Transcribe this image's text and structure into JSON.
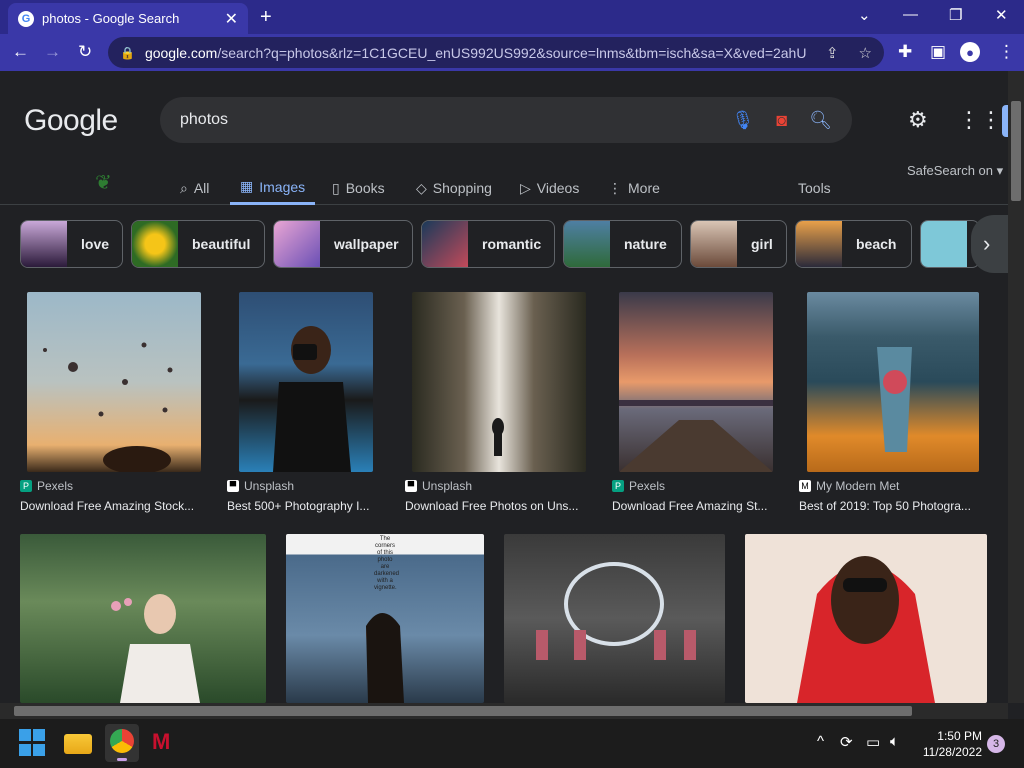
{
  "browser": {
    "tab_title": "photos - Google Search",
    "tab_favicon": "G",
    "url_host": "google.com",
    "url_rest": "/search?q=photos&rlz=1C1GCEU_enUS992US992&source=lnms&tbm=isch&sa=X&ved=2ahU..."
  },
  "page": {
    "logo": "Google",
    "query": "photos",
    "nav": [
      "All",
      "Images",
      "Books",
      "Shopping",
      "Videos",
      "More"
    ],
    "tools": "Tools",
    "safesearch": "SafeSearch on",
    "chips": [
      "love",
      "beautiful",
      "wallpaper",
      "romantic",
      "nature",
      "girl",
      "beach"
    ],
    "results": [
      {
        "source": "Pexels",
        "caption": "Download Free Amazing Stock..."
      },
      {
        "source": "Unsplash",
        "caption": "Best 500+ Photography I..."
      },
      {
        "source": "Unsplash",
        "caption": "Download Free Photos on Uns..."
      },
      {
        "source": "Pexels",
        "caption": "Download Free Amazing St..."
      },
      {
        "source": "My Modern Met",
        "caption": "Best of 2019: Top 50 Photogra..."
      }
    ],
    "vignette_note": "The corners of this photo are darkened with a vignette."
  },
  "taskbar": {
    "time": "1:50 PM",
    "date": "11/28/2022",
    "notifications": "3"
  }
}
